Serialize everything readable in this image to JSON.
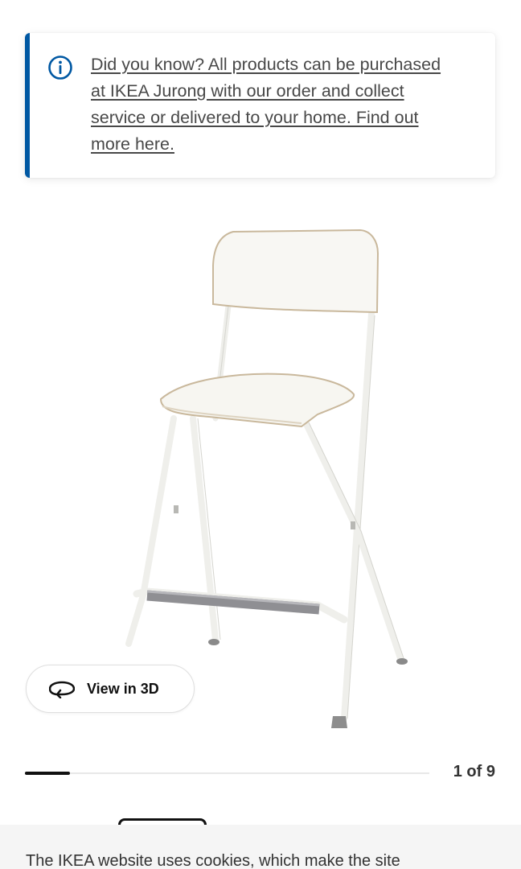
{
  "notice": {
    "icon": "info-icon",
    "link_text": "Did you know? All products can be purchased at IKEA Jurong with our order and collect service or delivered to your home. Find out more here.",
    "accent_color": "#0058a3"
  },
  "product_image": {
    "icon": "bar-stool-image"
  },
  "view3d": {
    "label": "View in 3D",
    "icon": "rotate-3d-icon"
  },
  "gallery": {
    "counter": "1 of 9",
    "current": 1,
    "total": 9
  },
  "cookie": {
    "text": "The IKEA website uses cookies, which make the site"
  }
}
